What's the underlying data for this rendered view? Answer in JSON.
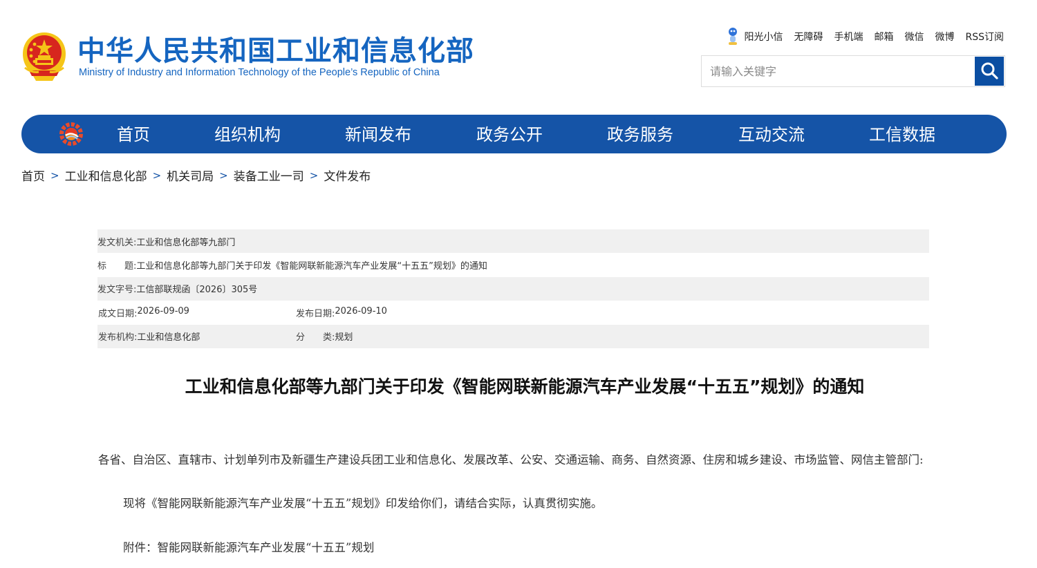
{
  "header": {
    "site_title": "中华人民共和国工业和信息化部",
    "site_subtitle": "Ministry of Industry and Information Technology of the People’s Republic of China",
    "top_links": [
      {
        "label": "阳光小信",
        "icon": "mascot-icon"
      },
      {
        "label": "无障碍"
      },
      {
        "label": "手机端"
      },
      {
        "label": "邮箱"
      },
      {
        "label": "微信"
      },
      {
        "label": "微博"
      },
      {
        "label": "RSS订阅"
      }
    ],
    "search": {
      "placeholder": "请输入关键字",
      "button_icon": "search-icon"
    }
  },
  "nav": {
    "logo_icon": "miit-gear-logo-icon",
    "items": [
      "首页",
      "组织机构",
      "新闻发布",
      "政务公开",
      "政务服务",
      "互动交流",
      "工信数据"
    ]
  },
  "breadcrumb": [
    "首页",
    "工业和信息化部",
    "机关司局",
    "装备工业一司",
    "文件发布"
  ],
  "breadcrumb_separator": ">",
  "info": {
    "issuer_label": "发文机关:",
    "issuer": "工业和信息化部等九部门",
    "subject_label": "标　　题:",
    "subject": "工业和信息化部等九部门关于印发《智能网联新能源汽车产业发展“十五五”规划》的通知",
    "doc_no_label": "发文字号:",
    "doc_no": "工信部联规函〔2026〕305号",
    "written_date_label": "成文日期:",
    "written_date": "2026-09-09",
    "publish_date_label": "发布日期:",
    "publish_date": "2026-09-10",
    "publisher_label": "发布机构:",
    "publisher": "工业和信息化部",
    "category_label": "分　　类:",
    "category": "规划"
  },
  "article": {
    "title": "工业和信息化部等九部门关于印发《智能网联新能源汽车产业发展“十五五”规划》的通知",
    "para1": "各省、自治区、直辖市、计划单列市及新疆生产建设兵团工业和信息化、发展改革、公安、交通运输、商务、自然资源、住房和城乡建设、市场监管、网信主管部门:",
    "para2": "现将《智能网联新能源汽车产业发展“十五五”规划》印发给你们，请结合实际，认真贯彻实施。",
    "para3": "附件：智能网联新能源汽车产业发展“十五五”规划"
  },
  "colors": {
    "brand_blue": "#1565c0",
    "nav_blue": "#1554a7",
    "search_button": "#0b4ea2",
    "emblem_red": "#d7261e",
    "emblem_gold": "#f5c518",
    "row_shade": "#f0f0f0"
  }
}
